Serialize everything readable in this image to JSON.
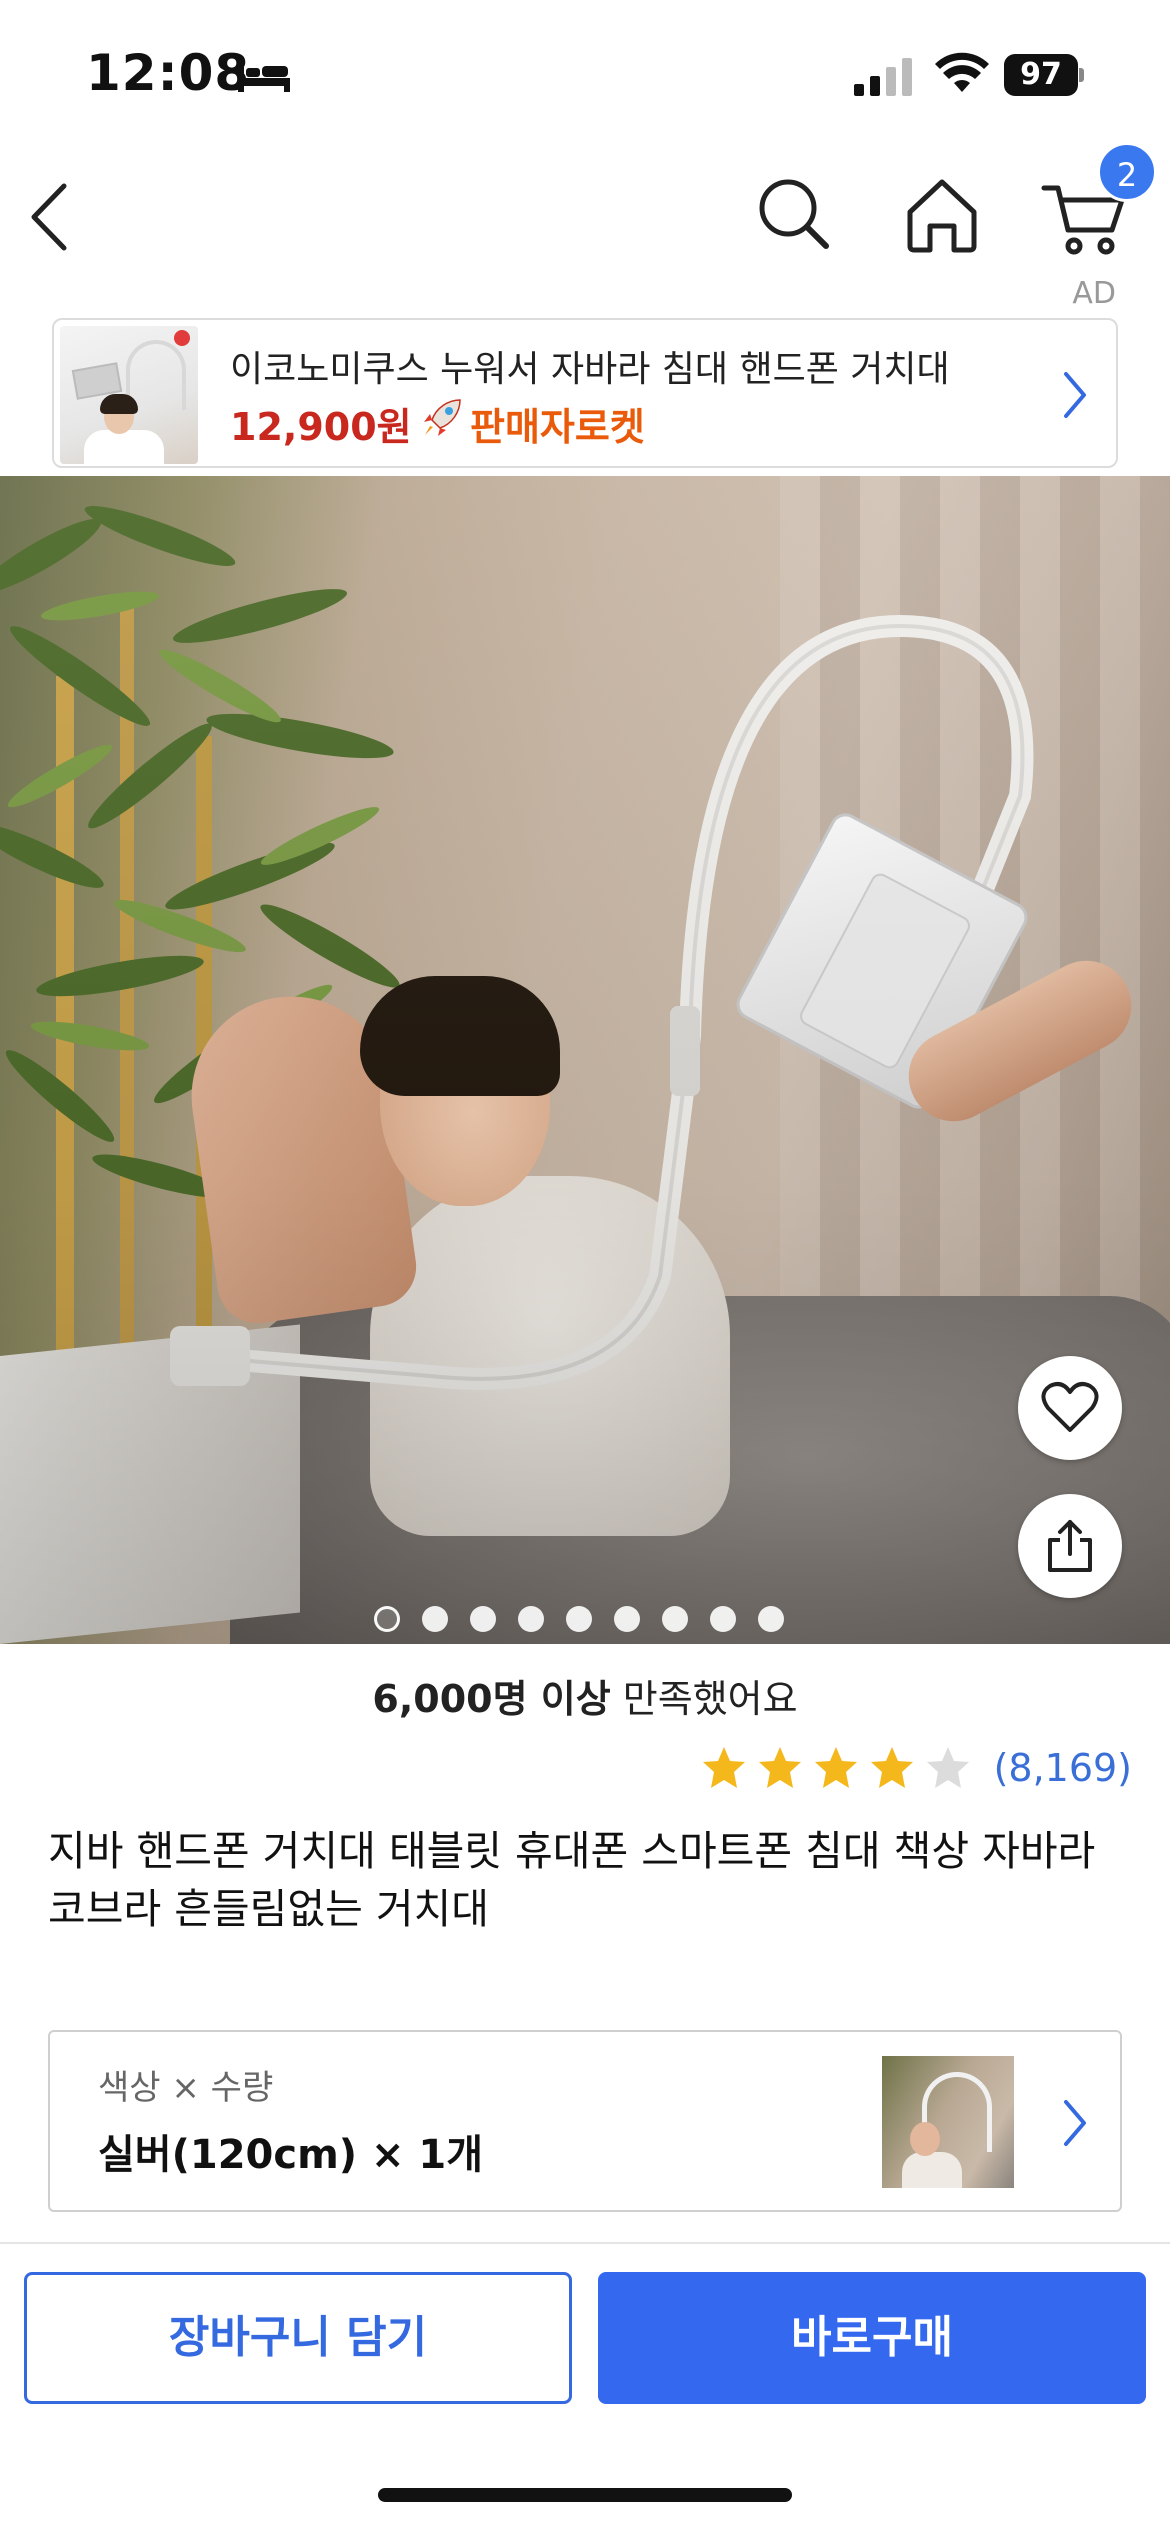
{
  "status_bar": {
    "time": "12:08",
    "battery": "97",
    "icons": [
      "bed-icon",
      "signal-icon",
      "wifi-icon",
      "battery-icon"
    ]
  },
  "nav": {
    "icons": [
      "back-icon",
      "search-icon",
      "home-icon",
      "cart-icon"
    ],
    "cart_badge": "2"
  },
  "ad": {
    "label": "AD",
    "title": "이코노미쿠스 누워서 자바라 침대 핸드폰 거치대",
    "price": "12,900원",
    "badge": "판매자로켓",
    "badge_icon": "rocket-icon"
  },
  "gallery": {
    "page_count": 9,
    "current_page": 1,
    "icons": [
      "heart-icon",
      "share-icon"
    ]
  },
  "product": {
    "satisfaction_bold": "6,000명 이상",
    "satisfaction_rest": " 만족했어요",
    "rating": 4,
    "rating_max": 5,
    "review_count": "(8,169)",
    "title": "지바 핸드폰 거치대 태블릿 휴대폰 스마트폰 침대 책상 자바라 코브라 흔들림없는 거치대"
  },
  "option": {
    "label": "색상 × 수량",
    "value": "실버(120cm) × 1개"
  },
  "actions": {
    "add_to_cart": "장바구니 담기",
    "buy_now": "바로구매"
  },
  "colors": {
    "accent": "#3469ef",
    "price_red": "#c8281e",
    "rocket_orange": "#ea5a0b",
    "star": "#f5b81c",
    "star_empty": "#dcdcdc",
    "review_link": "#3a6fd8"
  }
}
